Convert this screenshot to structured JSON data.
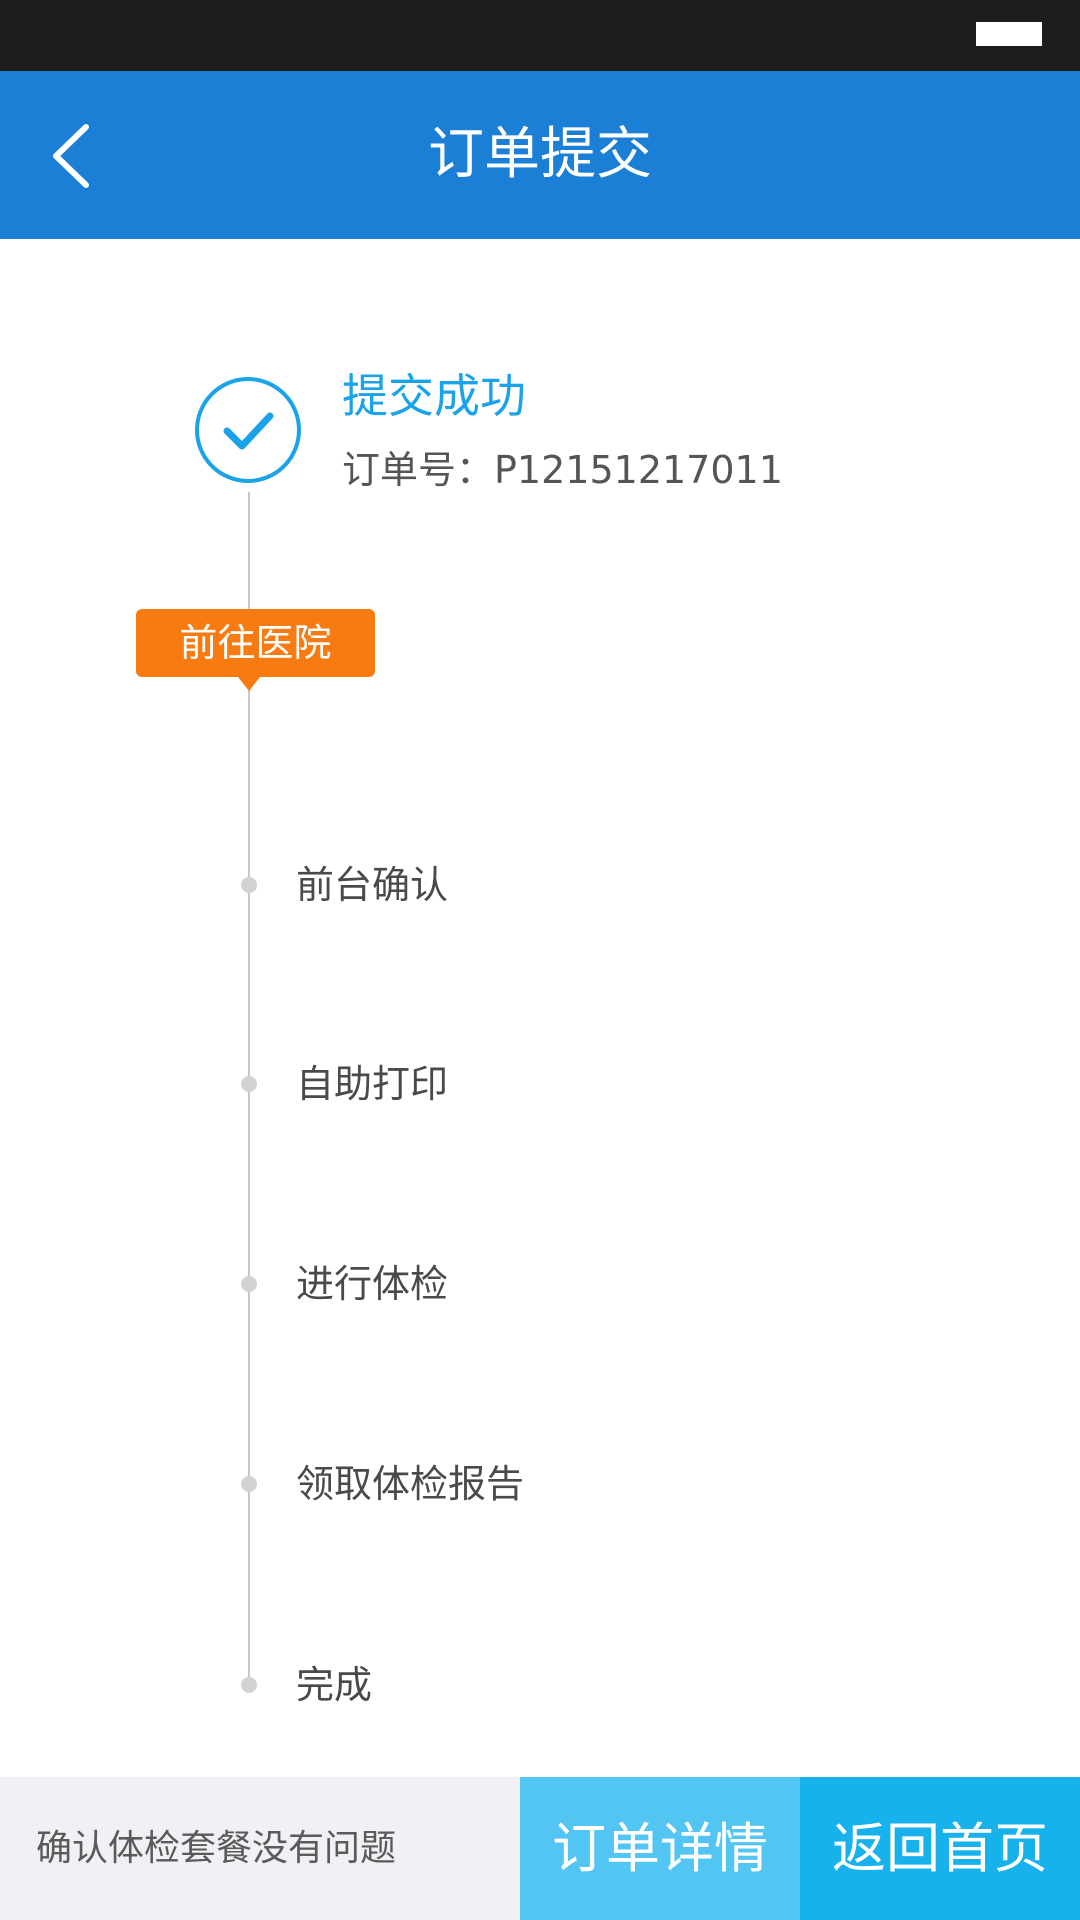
{
  "header": {
    "title": "订单提交",
    "back_icon": "chevron-left-icon"
  },
  "status_bar": {
    "battery_icon": "battery-icon"
  },
  "result": {
    "title": "提交成功",
    "order_number_label": "订单号：",
    "order_number": "P12151217011",
    "status_icon": "check-circle-icon"
  },
  "timeline": {
    "current_step": "前往医院",
    "steps": [
      {
        "label": "前台确认"
      },
      {
        "label": "自助打印"
      },
      {
        "label": "进行体检"
      },
      {
        "label": "领取体检报告"
      },
      {
        "label": "完成"
      }
    ]
  },
  "footer": {
    "note": "确认体检套餐没有问题",
    "order_detail_label": "订单详情",
    "home_label": "返回首页"
  },
  "colors": {
    "header": "#1c7fd6",
    "accent": "#1aa3e8",
    "tag": "#f77b11",
    "detail_button": "#53c5f3",
    "home_button": "#17b1ec"
  }
}
